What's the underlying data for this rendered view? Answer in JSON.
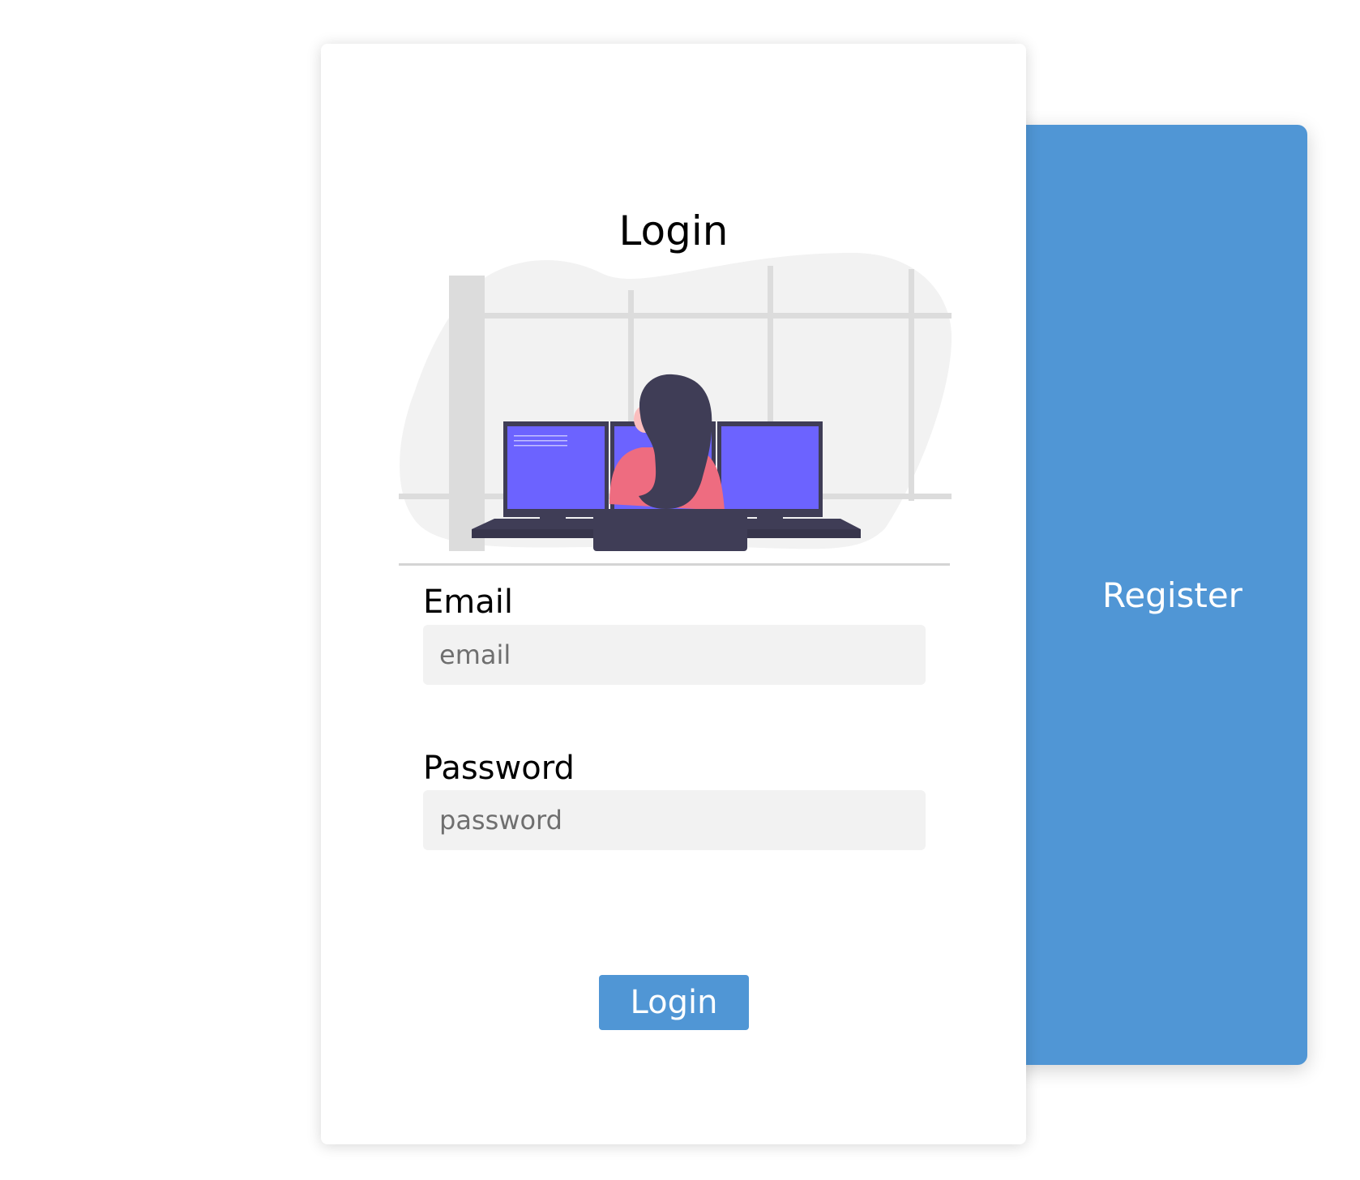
{
  "register_panel": {
    "label": "Register",
    "color": "#5096d5"
  },
  "login_card": {
    "title": "Login",
    "email": {
      "label": "Email",
      "placeholder": "email",
      "value": ""
    },
    "password": {
      "label": "Password",
      "placeholder": "password",
      "value": ""
    },
    "submit_label": "Login",
    "accent_color": "#5096d5"
  },
  "illustration": {
    "subject": "woman-at-desk-with-three-monitors",
    "colors": {
      "blob": "#f2f2f2",
      "window_frame": "#dcdcdc",
      "screen": "#6c63ff",
      "monitor_frame": "#3f3d56",
      "shirt": "#ee6c80",
      "hair": "#3f3d56",
      "skin": "#fbbebe"
    }
  }
}
